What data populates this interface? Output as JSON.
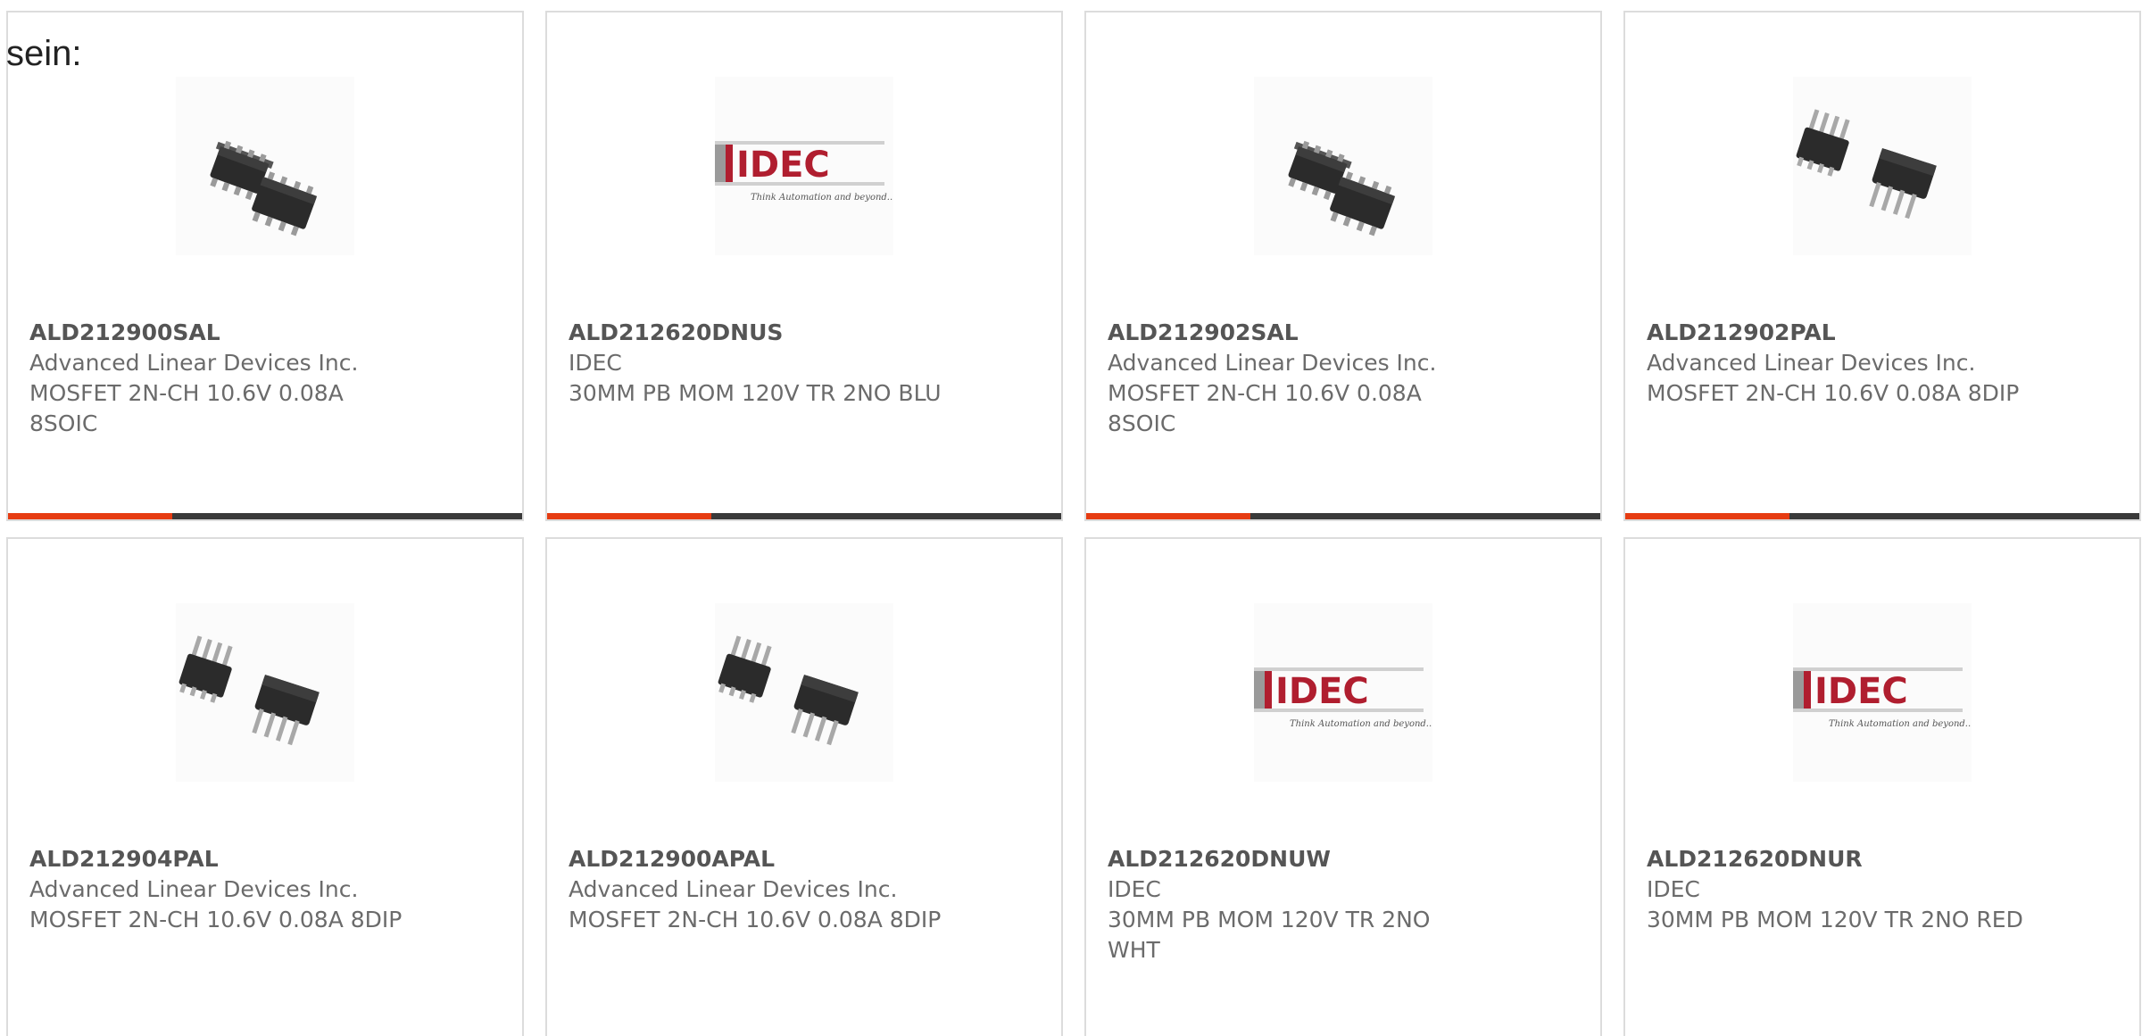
{
  "intro_text": "sein:",
  "colors": {
    "accent": "#e63c12",
    "bar_dark": "#3a3a3a",
    "border": "#dcdcdc",
    "text": "#6b6b6b",
    "idec_red": "#b01e2f"
  },
  "products": [
    {
      "part_number": "ALD212900SAL",
      "manufacturer": "Advanced Linear Devices Inc.",
      "description": "MOSFET 2N-CH 10.6V 0.08A 8SOIC",
      "image": "soic-8-chip-icon"
    },
    {
      "part_number": "ALD212620DNUS",
      "manufacturer": "IDEC",
      "description": "30MM PB MOM 120V TR 2NO BLU",
      "image": "idec-logo",
      "logo": {
        "brand": "IDEC",
        "tagline": "Think Automation and beyond..."
      }
    },
    {
      "part_number": "ALD212902SAL",
      "manufacturer": "Advanced Linear Devices Inc.",
      "description": "MOSFET 2N-CH 10.6V 0.08A 8SOIC",
      "image": "soic-8-chip-icon"
    },
    {
      "part_number": "ALD212902PAL",
      "manufacturer": "Advanced Linear Devices Inc.",
      "description": "MOSFET 2N-CH 10.6V 0.08A 8DIP",
      "image": "dip-8-chip-icon"
    },
    {
      "part_number": "ALD212904PAL",
      "manufacturer": "Advanced Linear Devices Inc.",
      "description": "MOSFET 2N-CH 10.6V 0.08A 8DIP",
      "image": "dip-8-chip-icon"
    },
    {
      "part_number": "ALD212900APAL",
      "manufacturer": "Advanced Linear Devices Inc.",
      "description": "MOSFET 2N-CH 10.6V 0.08A 8DIP",
      "image": "dip-8-chip-icon"
    },
    {
      "part_number": "ALD212620DNUW",
      "manufacturer": "IDEC",
      "description": "30MM PB MOM 120V TR 2NO WHT",
      "image": "idec-logo",
      "logo": {
        "brand": "IDEC",
        "tagline": "Think Automation and beyond..."
      }
    },
    {
      "part_number": "ALD212620DNUR",
      "manufacturer": "IDEC",
      "description": "30MM PB MOM 120V TR 2NO RED",
      "image": "idec-logo",
      "logo": {
        "brand": "IDEC",
        "tagline": "Think Automation and beyond..."
      }
    }
  ]
}
